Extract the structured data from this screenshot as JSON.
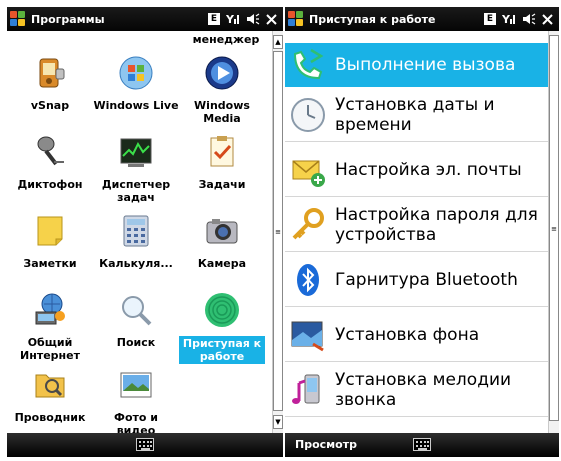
{
  "left": {
    "title": "Программы",
    "status": {
      "e_badge": "E",
      "signal": "Y̆ıl",
      "volume": "◀€",
      "close": "✕"
    },
    "partial_top_label": "менеджер",
    "apps": [
      {
        "id": "vsnap",
        "label": "vSnap"
      },
      {
        "id": "windows-live",
        "label": "Windows Live"
      },
      {
        "id": "windows-media",
        "label": "Windows Media"
      },
      {
        "id": "dictophone",
        "label": "Диктофон"
      },
      {
        "id": "task-manager",
        "label": "Диспетчер задач"
      },
      {
        "id": "tasks",
        "label": "Задачи"
      },
      {
        "id": "notes",
        "label": "Заметки"
      },
      {
        "id": "calculator",
        "label": "Калькуля..."
      },
      {
        "id": "camera",
        "label": "Камера"
      },
      {
        "id": "internet-sharing",
        "label": "Общий Интернет"
      },
      {
        "id": "search",
        "label": "Поиск"
      },
      {
        "id": "getting-started",
        "label": "Приступая к работе"
      },
      {
        "id": "explorer",
        "label": "Проводник"
      },
      {
        "id": "photos-videos",
        "label": "Фото и видео"
      }
    ],
    "softkeys": {
      "left": "",
      "right": ""
    }
  },
  "right": {
    "title": "Приступая к работе",
    "status": {
      "e_badge": "E",
      "signal": "Y̆ıl",
      "volume": "◀€",
      "close": "✕"
    },
    "items": [
      {
        "id": "make-call",
        "label": "Выполнение вызова"
      },
      {
        "id": "set-datetime",
        "label": "Установка даты и времени"
      },
      {
        "id": "setup-email",
        "label": "Настройка эл. почты"
      },
      {
        "id": "setup-password",
        "label": "Настройка пароля для устройства"
      },
      {
        "id": "bluetooth-headset",
        "label": "Гарнитура Bluetooth"
      },
      {
        "id": "set-background",
        "label": "Установка фона"
      },
      {
        "id": "set-ringtone",
        "label": "Установка мелодии звонка"
      }
    ],
    "softkeys": {
      "left": "Просмотр"
    }
  },
  "colors": {
    "accent": "#19b2e6",
    "titlebar": "#0a0a0a"
  }
}
